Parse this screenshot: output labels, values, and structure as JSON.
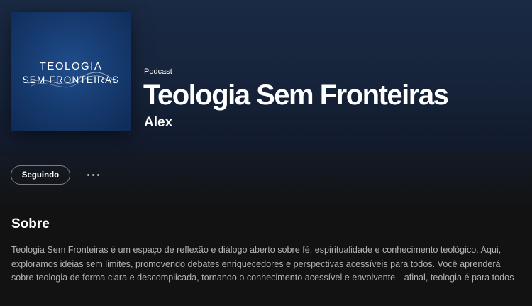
{
  "podcast": {
    "type_label": "Podcast",
    "title": "Teologia Sem Fronteiras",
    "author": "Alex",
    "cover": {
      "line1": "TEOLOGIA",
      "line2": "SEM FRONTEIRAS",
      "background_color": "#173d73",
      "icon": "cover-art-image"
    }
  },
  "actions": {
    "follow_label": "Seguindo",
    "more_icon": "more-options-icon"
  },
  "about": {
    "heading": "Sobre",
    "text": "Teologia Sem Fronteiras é um espaço de reflexão e diálogo aberto sobre fé, espiritualidade e conhecimento teológico. Aqui, exploramos ideias sem limites, promovendo debates enriquecedores e perspectivas acessíveis para todos. Você aprenderá sobre teologia de forma clara e descomplicada, tornando o conhecimento acessível e envolvente—afinal, teologia é para todos"
  },
  "colors": {
    "header_gradient": "#1a2a44",
    "background": "#121212",
    "secondary_text": "#b3b3b3"
  }
}
